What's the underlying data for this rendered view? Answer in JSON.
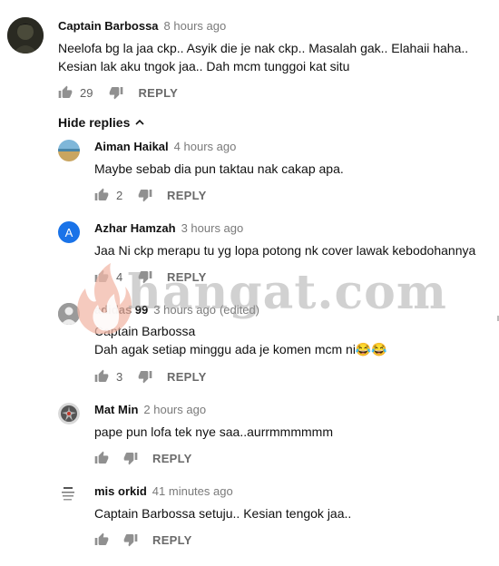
{
  "main_comment": {
    "author": "Captain Barbossa",
    "time": "8 hours ago",
    "text_lines": [
      "Neelofa bg la jaa ckp..  Asyik die je nak ckp..  Masalah gak..  Elahaii haha..",
      "Kesian lak aku tngok jaa..  Dah mcm tunggoi kat situ"
    ],
    "likes": "29",
    "reply_label": "REPLY"
  },
  "hide_replies_label": "Hide replies",
  "replies": [
    {
      "author": "Aiman Haikal",
      "time": "4 hours ago",
      "edited": "",
      "text_lines": [
        "Maybe sebab dia pun taktau nak cakap apa."
      ],
      "likes": "2",
      "reply_label": "REPLY"
    },
    {
      "author": "Azhar Hamzah",
      "time": "3 hours ago",
      "edited": "",
      "avatar_letter": "A",
      "text_lines": [
        "Jaa Ni ckp merapu tu yg lopa potong nk cover lawak kebodohannya"
      ],
      "likes": "4",
      "reply_label": "REPLY"
    },
    {
      "author": "adidas 99",
      "time": "3 hours ago",
      "edited": "(edited)",
      "text_lines": [
        "Captain Barbossa",
        "Dah agak setiap minggu ada je komen mcm ni😂😂"
      ],
      "likes": "3",
      "reply_label": "REPLY"
    },
    {
      "author": "Mat Min",
      "time": "2 hours ago",
      "edited": "",
      "text_lines": [
        "pape pun lofa tek nye saa..aurrmmmmmm"
      ],
      "likes": "",
      "reply_label": "REPLY"
    },
    {
      "author": "mis orkid",
      "time": "41 minutes ago",
      "edited": "",
      "text_lines": [
        "Captain Barbossa setuju.. Kesian tengok jaa.."
      ],
      "likes": "",
      "reply_label": "REPLY"
    }
  ],
  "watermark_text": "hangat.com",
  "colors": {
    "avatar_a": "#1a73e8",
    "text": "#111111",
    "meta": "#7a7a7a"
  }
}
